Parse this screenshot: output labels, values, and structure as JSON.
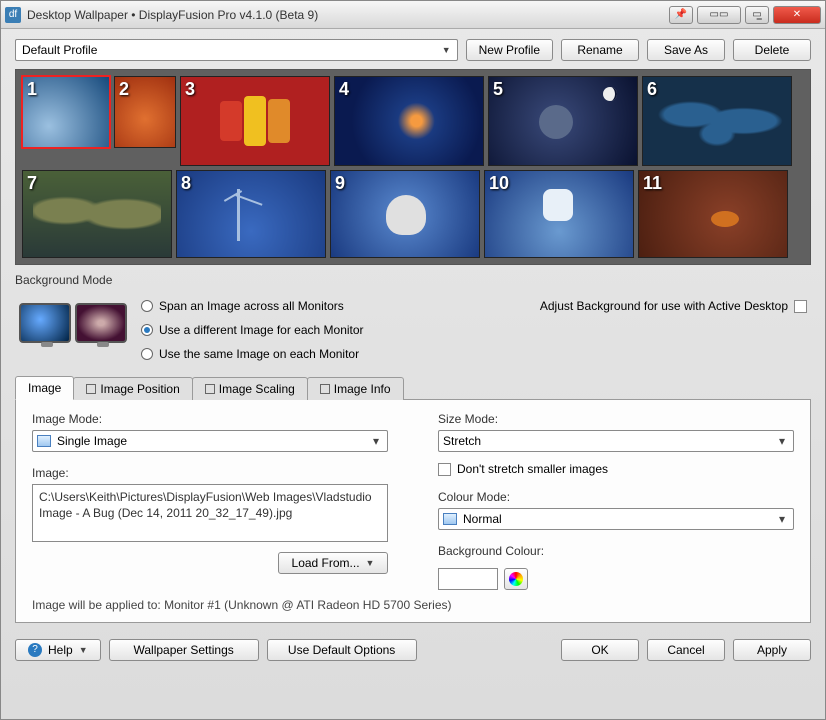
{
  "title": "Desktop Wallpaper • DisplayFusion Pro v4.1.0 (Beta 9)",
  "profile": {
    "selected": "Default Profile",
    "buttons": {
      "new": "New Profile",
      "rename": "Rename",
      "saveas": "Save As",
      "delete": "Delete"
    }
  },
  "monitors": {
    "selected": 1,
    "items": [
      "1",
      "2",
      "3",
      "4",
      "5",
      "6",
      "7",
      "8",
      "9",
      "10",
      "11"
    ]
  },
  "background_mode": {
    "heading": "Background Mode",
    "options": {
      "span": "Span an Image across all Monitors",
      "each": "Use a different Image for each Monitor",
      "same": "Use the same Image on each Monitor"
    },
    "selected": "each",
    "active_desktop_label": "Adjust Background for use with Active Desktop",
    "active_desktop_checked": false
  },
  "tabs": {
    "image": "Image",
    "image_position": "Image Position",
    "image_scaling": "Image Scaling",
    "image_info": "Image Info",
    "active": "image"
  },
  "image_tab": {
    "image_mode_label": "Image Mode:",
    "image_mode_value": "Single Image",
    "image_label": "Image:",
    "image_path": "C:\\Users\\Keith\\Pictures\\DisplayFusion\\Web Images\\Vladstudio Image - A Bug (Dec 14, 2011 20_32_17_49).jpg",
    "load_from": "Load From...",
    "size_mode_label": "Size Mode:",
    "size_mode_value": "Stretch",
    "dont_stretch_label": "Don't stretch smaller images",
    "dont_stretch_checked": false,
    "colour_mode_label": "Colour Mode:",
    "colour_mode_value": "Normal",
    "bg_colour_label": "Background Colour:",
    "applied_to": "Image will be applied to: Monitor #1 (Unknown @ ATI Radeon HD 5700 Series)"
  },
  "footer": {
    "help": "Help",
    "wallpaper_settings": "Wallpaper Settings",
    "use_defaults": "Use Default Options",
    "ok": "OK",
    "cancel": "Cancel",
    "apply": "Apply"
  }
}
